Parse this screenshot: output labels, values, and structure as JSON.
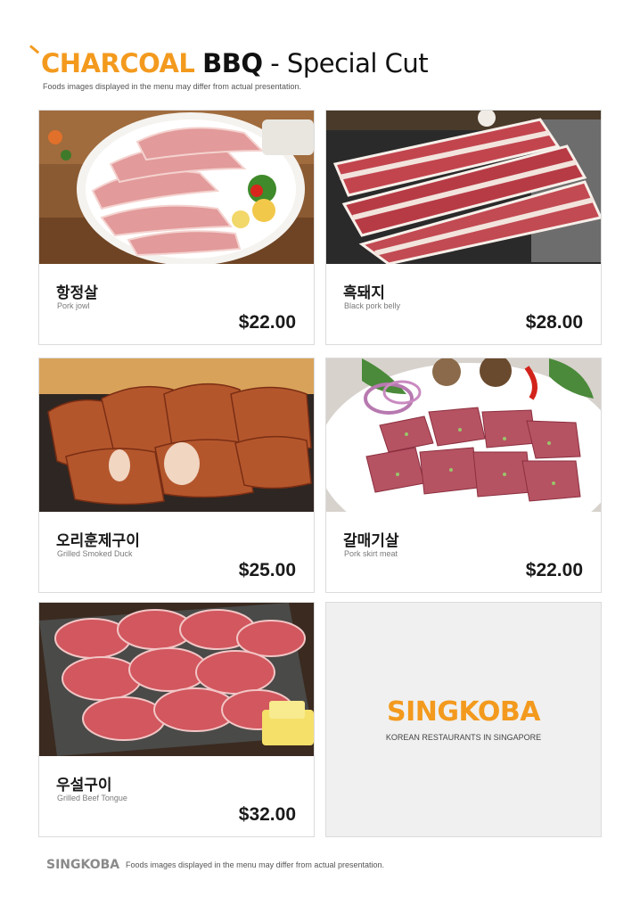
{
  "header": {
    "title_part1": "CHARCOAL",
    "title_part2": "BBQ",
    "title_part3": " - Special Cut",
    "subtitle": "Foods images displayed in the menu may differ from actual presentation."
  },
  "items": [
    {
      "name": "항정살",
      "name_en": "Pork jowl",
      "price": "$22.00"
    },
    {
      "name": "흑돼지",
      "name_en": "Black pork belly",
      "price": "$28.00"
    },
    {
      "name": "오리훈제구이",
      "name_en": "Grilled Smoked Duck",
      "price": "$25.00"
    },
    {
      "name": "갈매기살",
      "name_en": "Pork skirt meat",
      "price": "$22.00"
    },
    {
      "name": "우설구이",
      "name_en": "Grilled Beef Tongue",
      "price": "$32.00"
    }
  ],
  "brand_card": {
    "name": "SINGKOBA",
    "tagline": "KOREAN RESTAURANTS IN SINGAPORE"
  },
  "footer": {
    "brand": "SINGKOBA",
    "note": "Foods images displayed in the menu may differ from actual presentation."
  },
  "colors": {
    "accent": "#f39a1e",
    "card_border": "#dcdcdc",
    "brand_card_bg": "#f0f0f0"
  }
}
